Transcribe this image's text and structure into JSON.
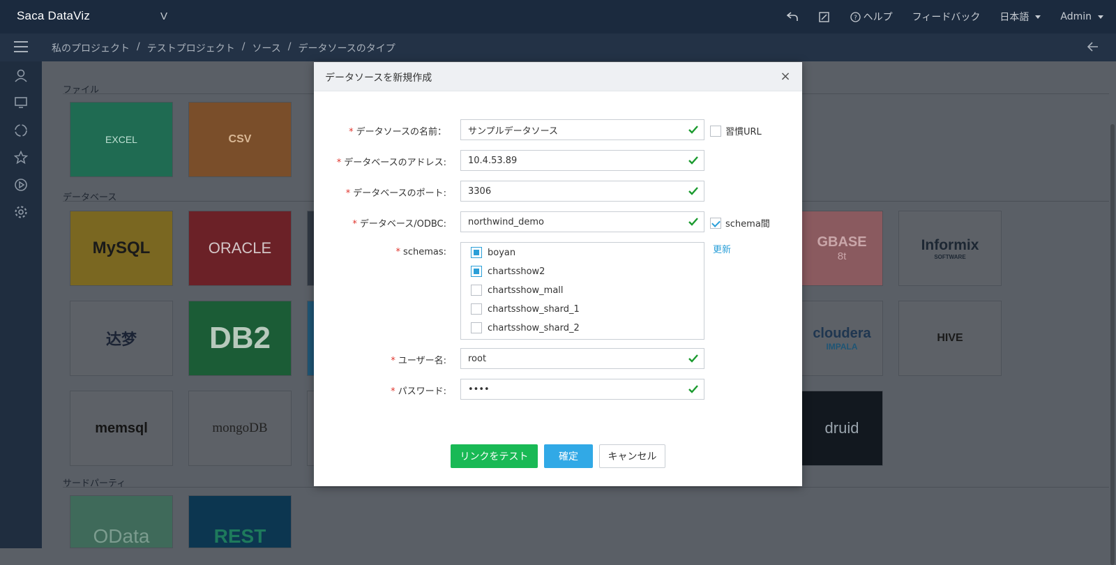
{
  "app": {
    "logo": "Saca DataViz",
    "version_mark": "V"
  },
  "topbar": {
    "help": "ヘルプ",
    "feedback": "フィードバック",
    "language": "日本語",
    "user": "Admin"
  },
  "breadcrumb": [
    "私のプロジェクト",
    "テストプロジェクト",
    "ソース",
    "データソースのタイプ"
  ],
  "breadcrumb_sep": "/",
  "sections": {
    "file": "ファイル",
    "database": "データベース",
    "third_party": "サードパーティ"
  },
  "tiles": {
    "excel": "EXCEL",
    "csv": "CSV",
    "mysql": "MySQL",
    "oracle": "ORACLE",
    "gbase": "GBASE",
    "gbase_sub": "8t",
    "informix": "Informix",
    "informix_sub": "SOFTWARE",
    "dameng": "达梦",
    "db2": "DB2",
    "cloudera": "cloudera",
    "cloudera_sub": "IMPALA",
    "hive": "HIVE",
    "memsql": "memsql",
    "mongodb": "mongoDB",
    "druid": "druid",
    "odata": "OData",
    "rest": "REST"
  },
  "modal": {
    "title": "データソースを新規作成",
    "fields": {
      "name_label": "データソースの名前：",
      "name_value": "サンプルデータソース",
      "custom_url_label": "習慣URL",
      "address_label": "データベースのアドレス:",
      "address_value": "10.4.53.89",
      "port_label": "データベースのポート:",
      "port_value": "3306",
      "db_label": "データベース/ODBC:",
      "db_value": "northwind_demo",
      "schema_between_label": "schema間",
      "schemas_label": "schemas:",
      "refresh_label": "更新",
      "user_label": "ユーザー名:",
      "user_value": "root",
      "password_label": "パスワード:",
      "password_value": "••••"
    },
    "required_mark": "*",
    "schemas": [
      {
        "name": "boyan",
        "checked": true
      },
      {
        "name": "chartsshow2",
        "checked": true
      },
      {
        "name": "chartsshow_mall",
        "checked": false
      },
      {
        "name": "chartsshow_shard_1",
        "checked": false
      },
      {
        "name": "chartsshow_shard_2",
        "checked": false
      }
    ],
    "buttons": {
      "test": "リンクをテスト",
      "ok": "確定",
      "cancel": "キャンセル"
    },
    "close_symbol": "×"
  },
  "colors": {
    "topbar": "#1b2a3e",
    "accent_blue": "#31a9e6",
    "accent_green": "#19b955",
    "required": "#e0352d",
    "valid_check": "#1a9a2e"
  }
}
